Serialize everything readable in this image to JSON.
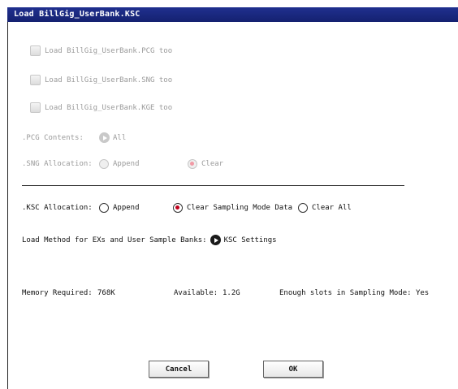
{
  "dialog": {
    "title": "Load BillGig_UserBank.KSC"
  },
  "options": {
    "load_pcg": "Load BillGig_UserBank.PCG too",
    "load_sng": "Load BillGig_UserBank.SNG too",
    "load_kge": "Load BillGig_UserBank.KGE too"
  },
  "pcg_contents": {
    "label": ".PCG Contents:",
    "value": "All"
  },
  "sng_allocation": {
    "label": ".SNG Allocation:",
    "append": "Append",
    "clear": "Clear",
    "selected": "Clear"
  },
  "ksc_allocation": {
    "label": ".KSC Allocation:",
    "append": "Append",
    "clear_sampling": "Clear Sampling Mode Data",
    "clear_all": "Clear All",
    "selected": "Clear Sampling Mode Data"
  },
  "load_method": {
    "label": "Load Method for EXs and User Sample Banks:",
    "value": "KSC Settings"
  },
  "memory": {
    "required_label": "Memory Required:",
    "required_value": "768K",
    "available_label": "Available:",
    "available_value": "1.2G",
    "slots_text": "Enough slots in Sampling Mode: Yes"
  },
  "buttons": {
    "cancel": "Cancel",
    "ok": "OK"
  },
  "colors": {
    "titlebar": "#1b2a85",
    "radio_selected": "#c0001c"
  }
}
